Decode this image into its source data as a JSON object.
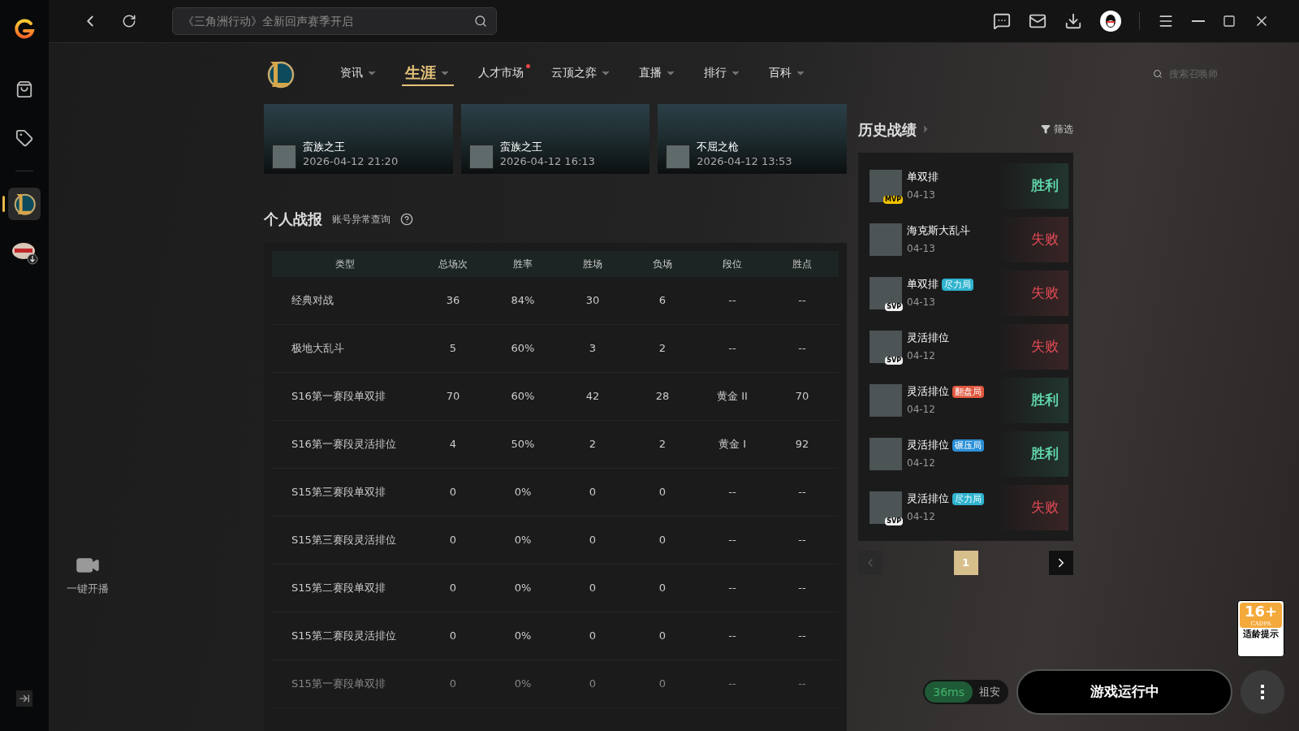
{
  "sidebar": {
    "items": [
      {
        "kind": "store",
        "selected": false
      },
      {
        "kind": "tag",
        "selected": false
      },
      {
        "kind": "lol",
        "selected": true
      },
      {
        "kind": "game",
        "selected": false
      }
    ],
    "stream_label": "一键开播"
  },
  "topbar": {
    "search": {
      "placeholder": "《三角洲行动》全新回声赛季开启"
    }
  },
  "nav": {
    "items": [
      {
        "label": "资讯",
        "selected": false,
        "dropdown": true,
        "dot": false
      },
      {
        "label": "生涯",
        "selected": true,
        "dropdown": true,
        "dot": false
      },
      {
        "label": "人才市场",
        "selected": false,
        "dropdown": false,
        "dot": true
      },
      {
        "label": "云顶之弈",
        "selected": false,
        "dropdown": true,
        "dot": false
      },
      {
        "label": "直播",
        "selected": false,
        "dropdown": true,
        "dot": false
      },
      {
        "label": "排行",
        "selected": false,
        "dropdown": true,
        "dot": false
      },
      {
        "label": "百科",
        "selected": false,
        "dropdown": true,
        "dot": false
      }
    ],
    "summoner_search": {
      "placeholder": "搜索召唤师"
    }
  },
  "highlights": [
    {
      "champion": "蛮族之王",
      "time": "2026-04-12 21:20"
    },
    {
      "champion": "蛮族之王",
      "time": "2026-04-12 16:13"
    },
    {
      "champion": "不屈之枪",
      "time": "2026-04-12 13:53"
    }
  ],
  "stats": {
    "title": "个人战报",
    "link": "账号异常查询",
    "columns": [
      "类型",
      "总场次",
      "胜率",
      "胜场",
      "负场",
      "段位",
      "胜点"
    ],
    "rows": [
      {
        "faded": false,
        "cells": [
          "经典对战",
          "36",
          "84%",
          "30",
          "6",
          "--",
          "--"
        ]
      },
      {
        "faded": false,
        "cells": [
          "极地大乱斗",
          "5",
          "60%",
          "3",
          "2",
          "--",
          "--"
        ]
      },
      {
        "faded": false,
        "cells": [
          "S16第一赛段单双排",
          "70",
          "60%",
          "42",
          "28",
          "黄金 II",
          "70"
        ]
      },
      {
        "faded": false,
        "cells": [
          "S16第一赛段灵活排位",
          "4",
          "50%",
          "2",
          "2",
          "黄金 I",
          "92"
        ]
      },
      {
        "faded": false,
        "cells": [
          "S15第三赛段单双排",
          "0",
          "0%",
          "0",
          "0",
          "--",
          "--"
        ]
      },
      {
        "faded": false,
        "cells": [
          "S15第三赛段灵活排位",
          "0",
          "0%",
          "0",
          "0",
          "--",
          "--"
        ]
      },
      {
        "faded": false,
        "cells": [
          "S15第二赛段单双排",
          "0",
          "0%",
          "0",
          "0",
          "--",
          "--"
        ]
      },
      {
        "faded": false,
        "cells": [
          "S15第二赛段灵活排位",
          "0",
          "0%",
          "0",
          "0",
          "--",
          "--"
        ]
      },
      {
        "faded": true,
        "cells": [
          "S15第一赛段单双排",
          "0",
          "0%",
          "0",
          "0",
          "--",
          "--"
        ]
      }
    ]
  },
  "history": {
    "title": "历史战绩",
    "filter": "筛选",
    "matches": [
      {
        "mode": "单双排",
        "date": "04-13",
        "badge": "MVP",
        "kind": "win",
        "result": "胜利"
      },
      {
        "mode": "海克斯大乱斗",
        "date": "04-13",
        "kind": "loss",
        "result": "失败"
      },
      {
        "mode": "单双排",
        "tag": {
          "label": "尽力局",
          "color": "#2fb3cf"
        },
        "date": "04-13",
        "badge": "SVP",
        "kind": "loss",
        "result": "失败"
      },
      {
        "mode": "灵活排位",
        "date": "04-12",
        "badge": "SVP",
        "kind": "loss",
        "result": "失败"
      },
      {
        "mode": "灵活排位",
        "tag": {
          "label": "翻盘局",
          "color": "#e0583e"
        },
        "date": "04-12",
        "kind": "win",
        "result": "胜利"
      },
      {
        "mode": "灵活排位",
        "tag": {
          "label": "碾压局",
          "color": "#2a8fd6"
        },
        "date": "04-12",
        "kind": "win",
        "result": "胜利"
      },
      {
        "mode": "灵活排位",
        "tag": {
          "label": "尽力局",
          "color": "#2fb3cf"
        },
        "date": "04-12",
        "badge": "SVP",
        "kind": "loss",
        "result": "失败"
      }
    ],
    "pages": [
      {
        "label": "1",
        "selected": true
      }
    ]
  },
  "bottom": {
    "ping": "36ms",
    "region": "祖安",
    "launch": "游戏运行中",
    "age": {
      "rating": "16+",
      "org": "CADPA",
      "label": "适龄提示"
    }
  }
}
